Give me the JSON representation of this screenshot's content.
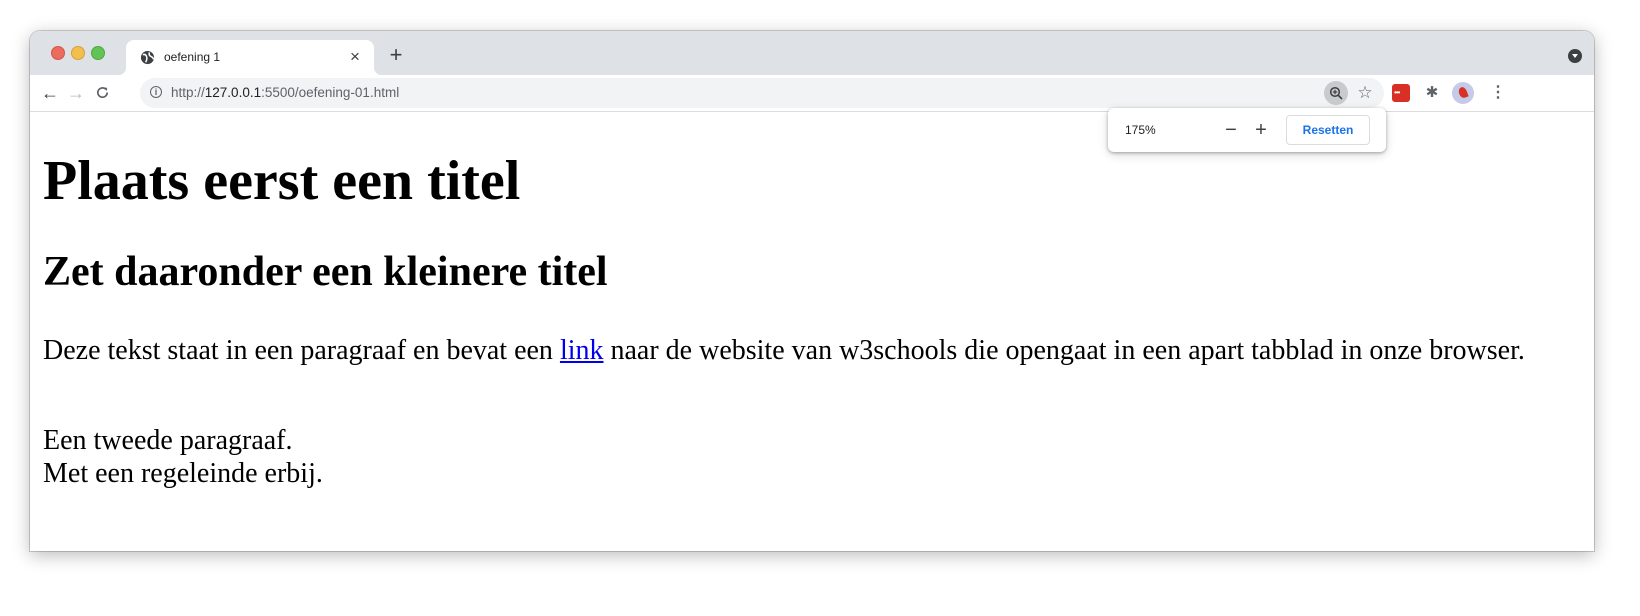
{
  "browser": {
    "tab": {
      "title": "oefening 1",
      "close_glyph": "×",
      "favicon": "globe-icon"
    },
    "new_tab_glyph": "+",
    "nav": {
      "back_glyph": "←",
      "forward_glyph": "→",
      "reload_glyph": "C"
    },
    "address": {
      "scheme": "http://",
      "host": "127.0.0.1",
      "rest": ":5500/oefening-01.html"
    },
    "toolbar_icons": [
      "zoom-icon",
      "star-icon",
      "extension-red-icon",
      "puzzle-icon",
      "avatar",
      "kebab-menu-icon"
    ],
    "star_glyph": "☆",
    "puzzle_glyph": "✱",
    "kebab_glyph": "⋮",
    "colors": {
      "tabstrip": "#dee1e6",
      "omnibox": "#f1f3f4",
      "accent": "#1a73e8",
      "link": "#0000ee"
    }
  },
  "zoom_bubble": {
    "level": "175%",
    "minus_glyph": "−",
    "plus_glyph": "+",
    "reset_label": "Resetten"
  },
  "page": {
    "h1": "Plaats eerst een titel",
    "h2": "Zet daaronder een kleinere titel",
    "p1_before": "Deze tekst staat in een paragraaf en bevat een ",
    "p1_link": "link",
    "p1_after": " naar de website van w3schools die opengaat in een apart tabblad in onze browser.",
    "p2_line1": "Een tweede paragraaf.",
    "p2_line2": "Met een regeleinde erbij."
  }
}
